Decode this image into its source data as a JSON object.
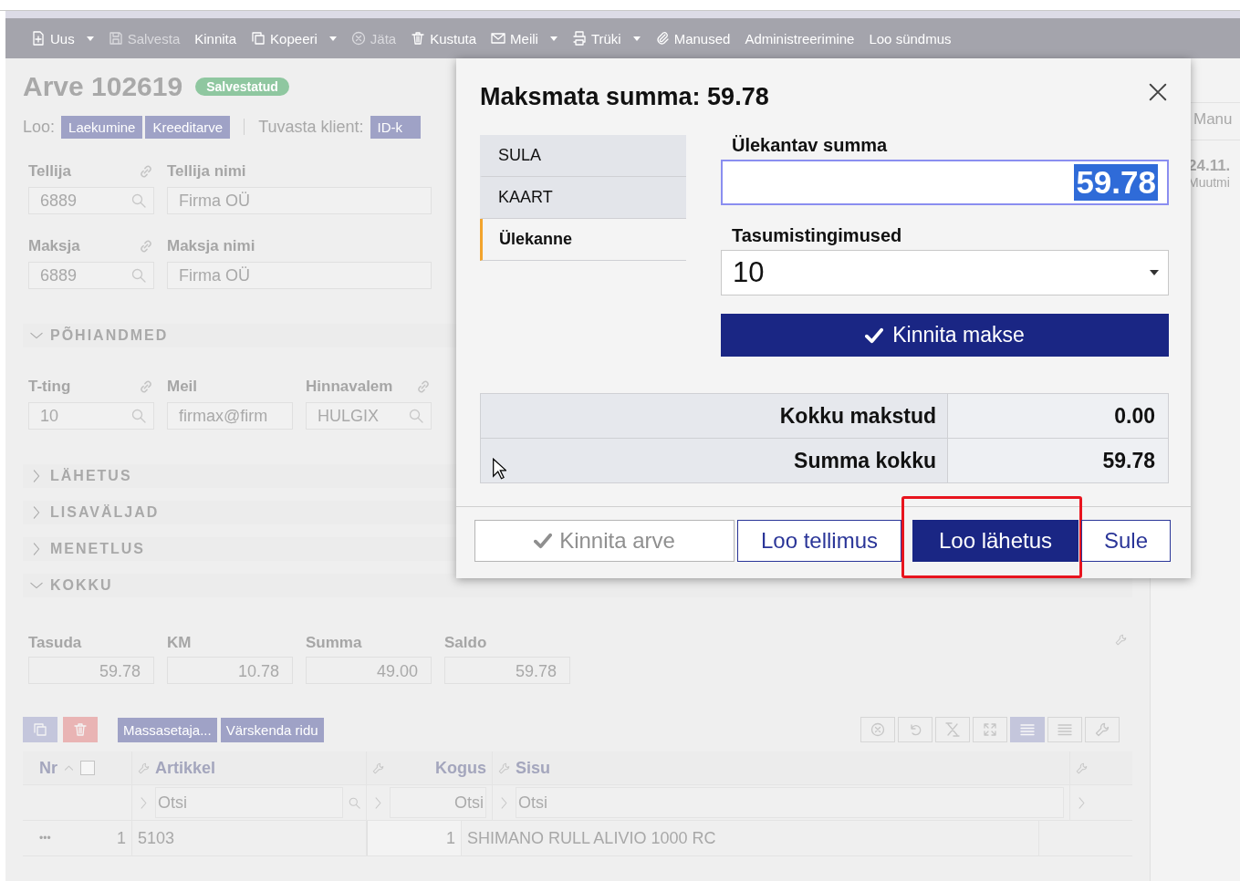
{
  "toolbar": [
    {
      "label": "Uus",
      "disabled": false,
      "dropdown": true
    },
    {
      "label": "Salvesta",
      "disabled": true,
      "dropdown": false
    },
    {
      "label": "Kinnita",
      "disabled": false,
      "dropdown": false
    },
    {
      "label": "Kopeeri",
      "disabled": false,
      "dropdown": true
    },
    {
      "label": "Jäta",
      "disabled": true,
      "dropdown": false
    },
    {
      "label": "Kustuta",
      "disabled": false,
      "dropdown": false
    },
    {
      "label": "Meili",
      "disabled": false,
      "dropdown": true
    },
    {
      "label": "Trüki",
      "disabled": false,
      "dropdown": true
    },
    {
      "label": "Manused",
      "disabled": false,
      "dropdown": false
    },
    {
      "label": "Administreerimine",
      "disabled": false,
      "dropdown": false
    },
    {
      "label": "Loo sündmus",
      "disabled": false,
      "dropdown": false
    }
  ],
  "document": {
    "title": "Arve 102619",
    "status": "Salvestatud"
  },
  "create": {
    "label": "Loo:",
    "buttons": [
      "Laekumine",
      "Kreeditarve"
    ]
  },
  "identify": {
    "label": "Tuvasta klient:",
    "button": "ID-k"
  },
  "field_rows": [
    [
      {
        "label": "Tellija",
        "value": "6889",
        "link": true,
        "search": true
      },
      {
        "label": "Tellija nimi",
        "value": "Firma OÜ",
        "link": false,
        "search": false
      }
    ],
    [
      {
        "label": "Maksja",
        "value": "6889",
        "link": true,
        "search": true
      },
      {
        "label": "Maksja nimi",
        "value": "Firma OÜ",
        "link": false,
        "search": false
      }
    ]
  ],
  "sections": [
    {
      "title": "PÕHIANDMED",
      "expanded": true,
      "fields": [
        {
          "label": "T-ting",
          "value": "10",
          "link": true,
          "search": true
        },
        {
          "label": "Meil",
          "value": "firmax@firm",
          "link": false,
          "search": false
        },
        {
          "label": "Hinnavalem",
          "value": "HULGIX",
          "link": true,
          "search": true
        }
      ]
    },
    {
      "title": "LÄHETUS",
      "expanded": false
    },
    {
      "title": "LISAVÄLJAD",
      "expanded": false
    },
    {
      "title": "MENETLUS",
      "expanded": false
    },
    {
      "title": "KOKKU",
      "expanded": true,
      "totals": [
        {
          "label": "Tasuda",
          "value": "59.78"
        },
        {
          "label": "KM",
          "value": "10.78"
        },
        {
          "label": "Summa",
          "value": "49.00"
        },
        {
          "label": "Saldo",
          "value": "59.78"
        }
      ]
    }
  ],
  "grid": {
    "tools": [
      "Massasetaja...",
      "Värskenda ridu"
    ],
    "view_tools": [
      {
        "selected": false
      },
      {
        "selected": false
      },
      {
        "selected": false
      },
      {
        "selected": false
      },
      {
        "selected": true
      },
      {
        "selected": false
      },
      {
        "selected": false
      }
    ]
  },
  "table": {
    "columns": [
      "Nr",
      "Artikkel",
      "Kogus",
      "Sisu"
    ],
    "all_checked": false,
    "filters": [
      {
        "placeholder": "Otsi"
      },
      {
        "placeholder": "Otsi"
      },
      {
        "placeholder": "Otsi"
      }
    ],
    "rows": [
      {
        "menu": "•••",
        "nr": "1",
        "artikkel": "5103",
        "kogus": "1",
        "sisu": "SHIMANO RULL ALIVIO 1000 RC"
      }
    ]
  },
  "side": {
    "tab": "Manu",
    "date": "24.11.",
    "note": "Muutmi"
  },
  "modal": {
    "title": "Maksmata summa: 59.78",
    "methods": [
      {
        "label": "SULA",
        "selected": false
      },
      {
        "label": "KAART",
        "selected": false
      },
      {
        "label": "Ülekanne",
        "selected": true
      }
    ],
    "amount": {
      "label": "Ülekantav summa",
      "value": "59.78"
    },
    "terms": {
      "label": "Tasumistingimused",
      "value": "10"
    },
    "confirm": "Kinnita makse",
    "summary": [
      {
        "label": "Kokku makstud",
        "value": "0.00"
      },
      {
        "label": "Summa kokku",
        "value": "59.78"
      }
    ],
    "buttons": [
      {
        "label": "Kinnita arve",
        "kind": "secondary",
        "disabled": true,
        "highlighted": false
      },
      {
        "label": "Loo tellimus",
        "kind": "secondary",
        "disabled": false,
        "highlighted": false
      },
      {
        "label": "Loo lähetus",
        "kind": "primary",
        "disabled": false,
        "highlighted": true
      },
      {
        "label": "Sule",
        "kind": "secondary",
        "disabled": false,
        "highlighted": false
      }
    ]
  }
}
